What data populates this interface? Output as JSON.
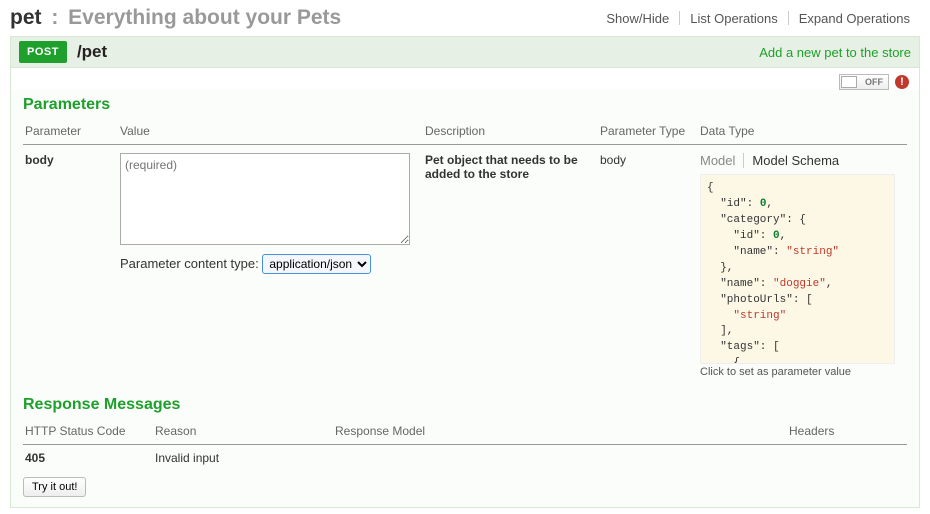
{
  "header": {
    "api_name": "pet",
    "api_desc": "Everything about your Pets",
    "links": {
      "show_hide": "Show/Hide",
      "list_ops": "List Operations",
      "expand_ops": "Expand Operations"
    }
  },
  "operation": {
    "method": "POST",
    "path": "/pet",
    "summary": "Add a new pet to the store",
    "toggle_label": "OFF"
  },
  "params_section": {
    "title": "Parameters",
    "columns": {
      "parameter": "Parameter",
      "value": "Value",
      "description": "Description",
      "ptype": "Parameter Type",
      "dtype": "Data Type"
    },
    "row": {
      "name": "body",
      "value_placeholder": "(required)",
      "content_type_label": "Parameter content type:",
      "content_type_value": "application/json",
      "description": "Pet object that needs to be added to the store",
      "ptype": "body",
      "model_tab": "Model",
      "schema_tab": "Model Schema",
      "schema_hint": "Click to set as parameter value",
      "schema": {
        "l1": "{",
        "l2a": "  \"id\": ",
        "l2b": "0",
        "l2c": ",",
        "l3": "  \"category\": {",
        "l4a": "    \"id\": ",
        "l4b": "0",
        "l4c": ",",
        "l5a": "    \"name\": ",
        "l5b": "\"string\"",
        "l6": "  },",
        "l7a": "  \"name\": ",
        "l7b": "\"doggie\"",
        "l7c": ",",
        "l8": "  \"photoUrls\": [",
        "l9": "    \"string\"",
        "l10": "  ],",
        "l11": "  \"tags\": [",
        "l12": "    {"
      }
    }
  },
  "responses_section": {
    "title": "Response Messages",
    "columns": {
      "code": "HTTP Status Code",
      "reason": "Reason",
      "model": "Response Model",
      "headers": "Headers"
    },
    "row": {
      "code": "405",
      "reason": "Invalid input"
    }
  },
  "try_button": "Try it out!"
}
